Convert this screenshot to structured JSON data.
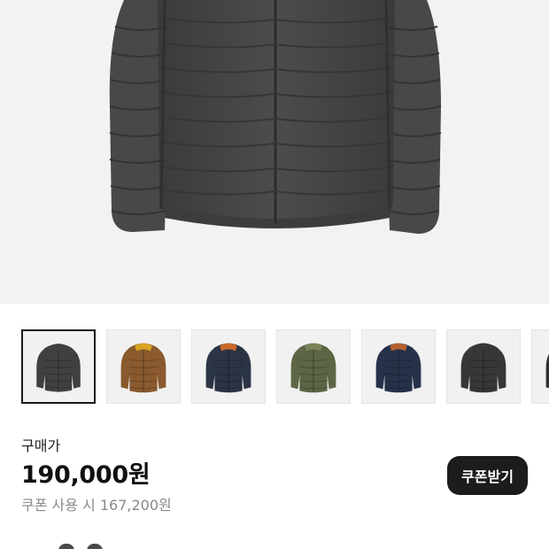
{
  "hero": {
    "image_icon": "jacket-image-icon"
  },
  "thumbnails": [
    {
      "name": "thumb-charcoal",
      "color": "#3f4140",
      "accent": "#3f4140",
      "selected": true
    },
    {
      "name": "thumb-mustard",
      "color": "#8a5a2e",
      "accent": "#d7a521",
      "selected": false
    },
    {
      "name": "thumb-navy-orange",
      "color": "#2b3445",
      "accent": "#c96a2a",
      "selected": false
    },
    {
      "name": "thumb-olive",
      "color": "#5d6644",
      "accent": "#7c8559",
      "selected": false
    },
    {
      "name": "thumb-navy",
      "color": "#26324a",
      "accent": "#b86030",
      "selected": false
    },
    {
      "name": "thumb-black",
      "color": "#353738",
      "accent": "#353738",
      "selected": false
    },
    {
      "name": "thumb-partial",
      "color": "#2f3130",
      "accent": "#2f3130",
      "selected": false
    }
  ],
  "purchase": {
    "label": "구매가",
    "price": "190,000원",
    "coupon_price": "쿠폰 사용 시 167,200원",
    "coupon_button": "쿠폰받기"
  },
  "colors": {
    "hero_bg": "#f2f2f2",
    "button_bg": "#1c1c1c",
    "muted_text": "#8a8a8a"
  }
}
